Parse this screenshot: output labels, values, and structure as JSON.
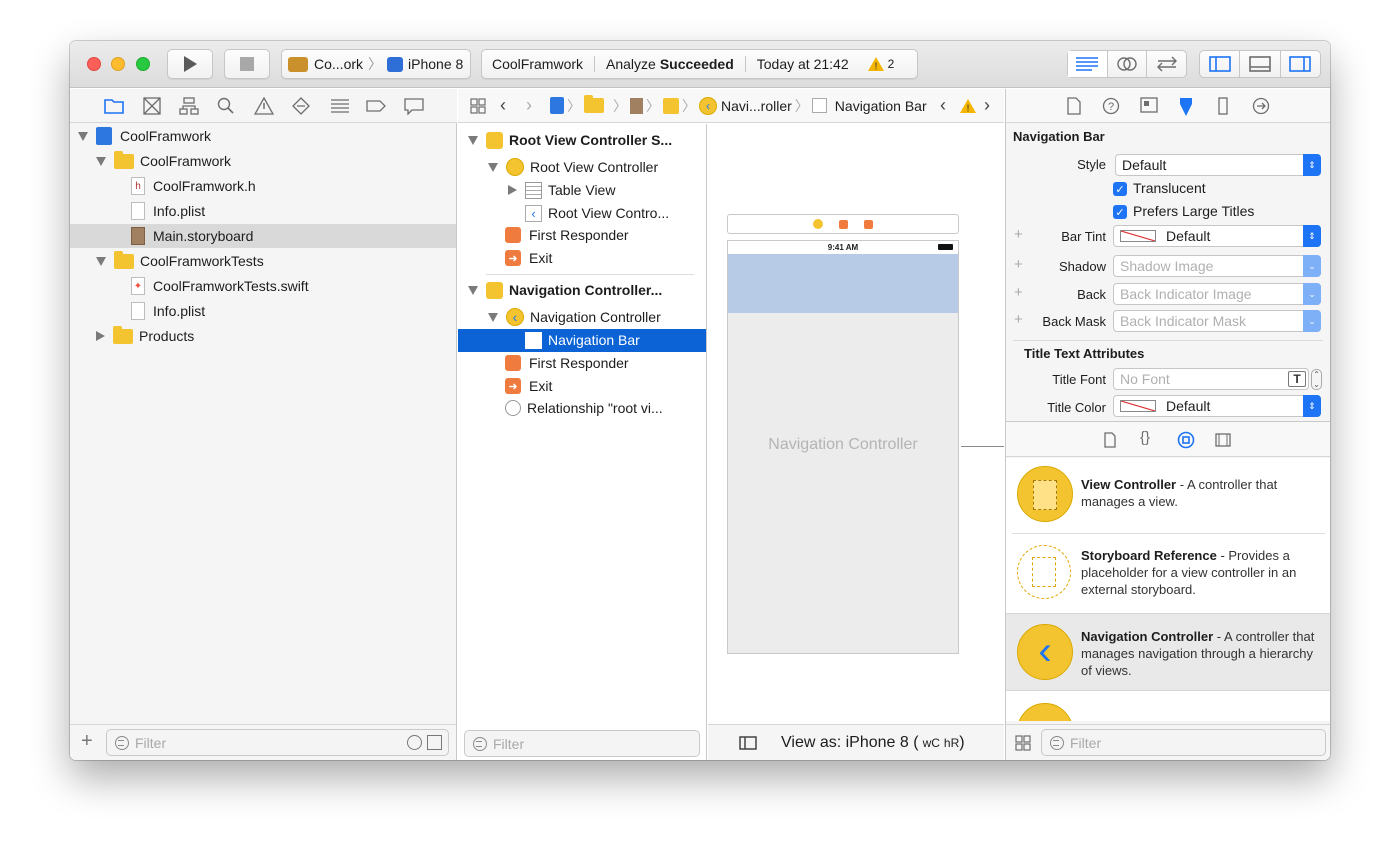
{
  "toolbar": {
    "scheme": "Co...ork",
    "device": "iPhone 8",
    "status_project": "CoolFramwork",
    "status_action": "Analyze",
    "status_result": "Succeeded",
    "status_time": "Today at 21:42",
    "warning_count": "2"
  },
  "navigator": {
    "items": [
      {
        "label": "CoolFramwork"
      },
      {
        "label": "CoolFramwork"
      },
      {
        "label": "CoolFramwork.h"
      },
      {
        "label": "Info.plist"
      },
      {
        "label": "Main.storyboard"
      },
      {
        "label": "CoolFramworkTests"
      },
      {
        "label": "CoolFramworkTests.swift"
      },
      {
        "label": "Info.plist"
      },
      {
        "label": "Products"
      }
    ],
    "filter_placeholder": "Filter"
  },
  "jumpbar": {
    "crumb": "Navi...roller",
    "current": "Navigation Bar"
  },
  "outline": {
    "items": [
      {
        "label": "Root View Controller S..."
      },
      {
        "label": "Root View Controller"
      },
      {
        "label": "Table View"
      },
      {
        "label": "Root View Contro..."
      },
      {
        "label": "First Responder"
      },
      {
        "label": "Exit"
      },
      {
        "label": "Navigation Controller..."
      },
      {
        "label": "Navigation Controller"
      },
      {
        "label": "Navigation Bar"
      },
      {
        "label": "First Responder"
      },
      {
        "label": "Exit"
      },
      {
        "label": "Relationship \"root vi..."
      }
    ],
    "filter_placeholder": "Filter"
  },
  "canvas": {
    "status_time": "9:41 AM",
    "scene_label": "Navigation Controller",
    "view_as": "View as: iPhone 8 (",
    "size_w": "wC",
    "size_h": "hR",
    "view_as_end": ")"
  },
  "inspector": {
    "section_title": "Navigation Bar",
    "style_label": "Style",
    "style_value": "Default",
    "translucent_label": "Translucent",
    "large_titles_label": "Prefers Large Titles",
    "bar_tint_label": "Bar Tint",
    "bar_tint_value": "Default",
    "shadow_label": "Shadow",
    "shadow_placeholder": "Shadow Image",
    "back_label": "Back",
    "back_placeholder": "Back Indicator Image",
    "back_mask_label": "Back Mask",
    "back_mask_placeholder": "Back Indicator Mask",
    "title_attrs_heading": "Title Text Attributes",
    "title_font_label": "Title Font",
    "title_font_placeholder": "No Font",
    "title_color_label": "Title Color",
    "title_color_value": "Default"
  },
  "library": {
    "items": [
      {
        "title": "View Controller",
        "desc": " - A controller that manages a view."
      },
      {
        "title": "Storyboard Reference",
        "desc": " - Provides a placeholder for a view controller in an external storyboard."
      },
      {
        "title": "Navigation Controller",
        "desc": " - A controller that manages navigation through a hierarchy of views."
      }
    ],
    "filter_placeholder": "Filter"
  },
  "colors": {
    "accent": "#1d74f5",
    "selection": "#0b63d6",
    "warning": "#f4b400",
    "folder": "#f4c430"
  }
}
